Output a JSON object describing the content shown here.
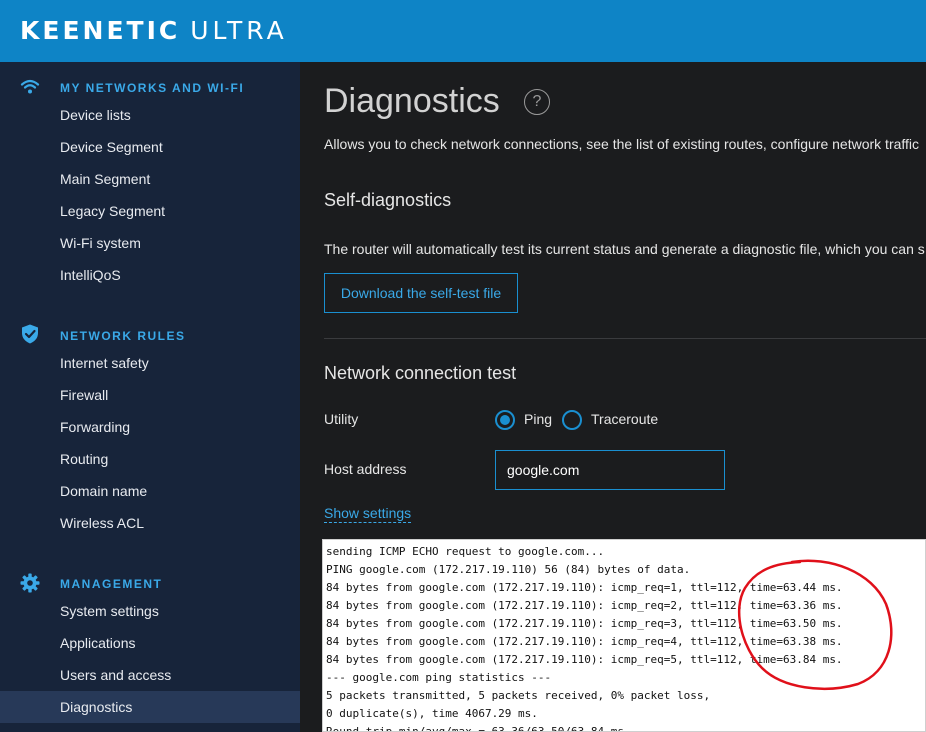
{
  "header": {
    "brand_main": "KEENETIC",
    "brand_model": "ULTRA"
  },
  "sidebar": {
    "sections": [
      {
        "title": "MY NETWORKS AND WI-FI",
        "icon": "wifi-icon",
        "items": [
          "Device lists",
          "Device Segment",
          "Main Segment",
          "Legacy Segment",
          "Wi-Fi system",
          "IntelliQoS"
        ]
      },
      {
        "title": "NETWORK RULES",
        "icon": "shield-icon",
        "items": [
          "Internet safety",
          "Firewall",
          "Forwarding",
          "Routing",
          "Domain name",
          "Wireless ACL"
        ]
      },
      {
        "title": "MANAGEMENT",
        "icon": "gear-icon",
        "items": [
          "System settings",
          "Applications",
          "Users and access",
          "Diagnostics"
        ]
      }
    ],
    "active_item": "Diagnostics"
  },
  "page": {
    "title": "Diagnostics",
    "help_glyph": "?",
    "description": "Allows you to check network connections, see the list of existing routes, configure network traffic",
    "self_diag": {
      "heading": "Self-diagnostics",
      "text": "The router will automatically test its current status and generate a diagnostic file, which you can s",
      "button_label": "Download the self-test file"
    },
    "conn_test": {
      "heading": "Network connection test",
      "utility_label": "Utility",
      "options": [
        "Ping",
        "Traceroute"
      ],
      "selected": "Ping",
      "host_label": "Host address",
      "host_value": "google.com",
      "show_settings": "Show settings"
    },
    "console_lines": [
      "sending ICMP ECHO request to google.com...",
      "PING google.com (172.217.19.110) 56 (84) bytes of data.",
      "84 bytes from google.com (172.217.19.110): icmp_req=1, ttl=112, time=63.44 ms.",
      "84 bytes from google.com (172.217.19.110): icmp_req=2, ttl=112, time=63.36 ms.",
      "84 bytes from google.com (172.217.19.110): icmp_req=3, ttl=112, time=63.50 ms.",
      "84 bytes from google.com (172.217.19.110): icmp_req=4, ttl=112, time=63.38 ms.",
      "84 bytes from google.com (172.217.19.110): icmp_req=5, ttl=112, time=63.84 ms.",
      "--- google.com ping statistics ---",
      "5 packets transmitted, 5 packets received, 0% packet loss,",
      "0 duplicate(s), time 4067.29 ms.",
      "Round-trip min/avg/max = 63.36/63.50/63.84 ms."
    ]
  },
  "colors": {
    "header_bg": "#0e84c6",
    "sidebar_bg": "#17243a",
    "sidebar_active_bg": "#273958",
    "accent": "#1a8fd0",
    "section_title": "#3aa9e8",
    "annotation_red": "#e0101a"
  }
}
